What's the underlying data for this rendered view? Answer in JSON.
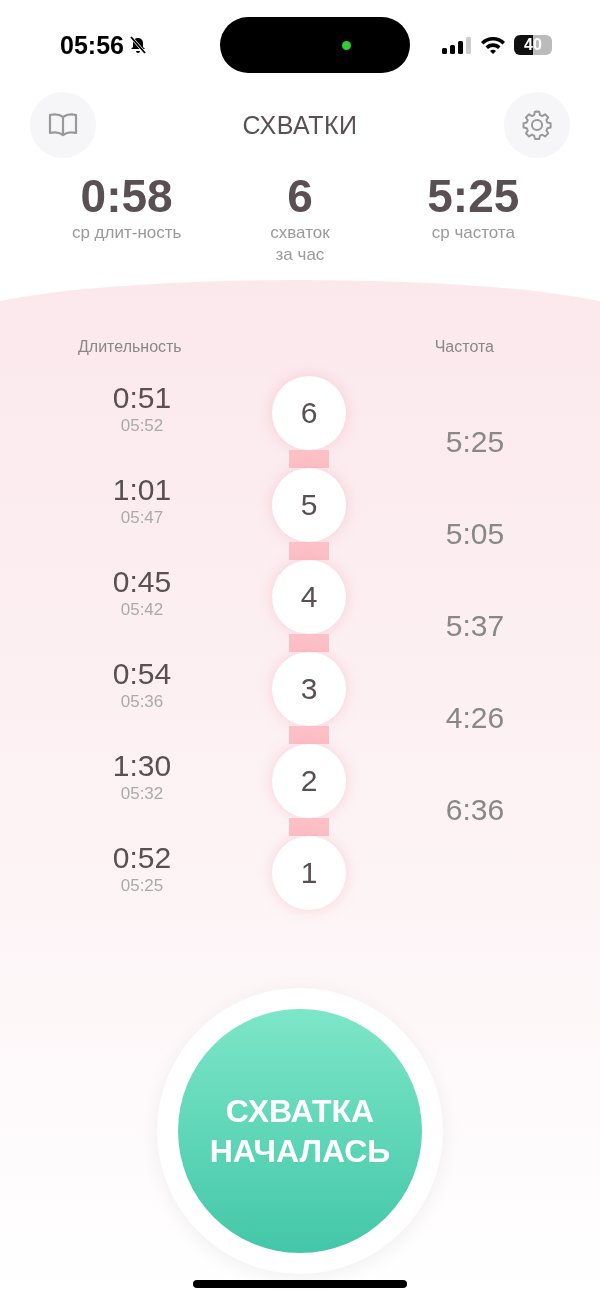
{
  "status_bar": {
    "time": "05:56",
    "silent": true,
    "battery": "40"
  },
  "header": {
    "title": "СХВАТКИ"
  },
  "stats": [
    {
      "value": "0:58",
      "label": "ср длит-ность"
    },
    {
      "value": "6",
      "label": "схваток\nза час"
    },
    {
      "value": "5:25",
      "label": "ср частота"
    }
  ],
  "columns": {
    "duration": "Длительность",
    "frequency": "Частота"
  },
  "contractions": [
    {
      "number": "6",
      "duration": "0:51",
      "start": "05:52"
    },
    {
      "number": "5",
      "duration": "1:01",
      "start": "05:47"
    },
    {
      "number": "4",
      "duration": "0:45",
      "start": "05:42"
    },
    {
      "number": "3",
      "duration": "0:54",
      "start": "05:36"
    },
    {
      "number": "2",
      "duration": "1:30",
      "start": "05:32"
    },
    {
      "number": "1",
      "duration": "0:52",
      "start": "05:25"
    }
  ],
  "frequencies": [
    "5:25",
    "5:05",
    "5:37",
    "4:26",
    "6:36"
  ],
  "start_button": {
    "label": "СХВАТКА\nНАЧАЛАСЬ"
  }
}
